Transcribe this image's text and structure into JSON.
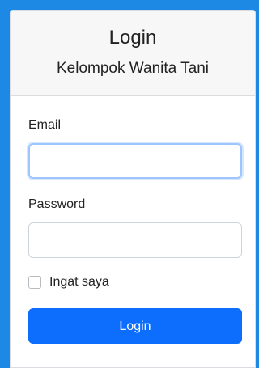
{
  "header": {
    "title": "Login",
    "subtitle": "Kelompok Wanita Tani"
  },
  "form": {
    "email_label": "Email",
    "email_value": "",
    "password_label": "Password",
    "password_value": "",
    "remember_label": "Ingat saya",
    "remember_checked": false,
    "submit_label": "Login"
  },
  "colors": {
    "background": "#1e88e5",
    "button": "#0d6efd",
    "header": "#f7f7f7"
  }
}
